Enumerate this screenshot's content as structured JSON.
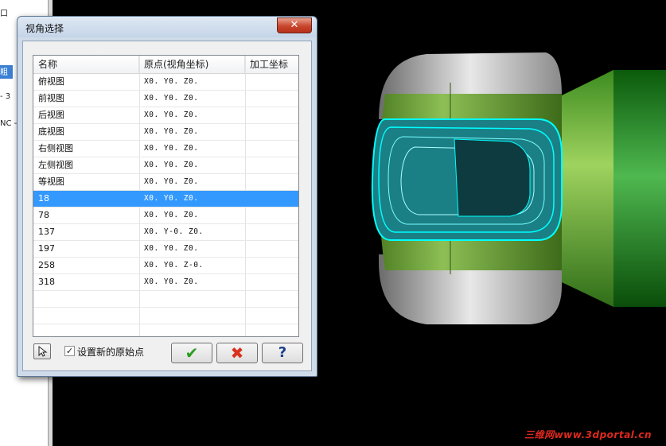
{
  "left_panel": {
    "items": [
      "口",
      "粗加",
      "- 3",
      "NC -"
    ]
  },
  "dialog": {
    "title": "视角选择",
    "close_label": "✕",
    "columns": [
      "名称",
      "原点(视角坐标)",
      "加工坐标"
    ],
    "rows": [
      {
        "name": "俯视图",
        "origin": "X0. Y0. Z0.",
        "machining": ""
      },
      {
        "name": "前视图",
        "origin": "X0. Y0. Z0.",
        "machining": ""
      },
      {
        "name": "后视图",
        "origin": "X0. Y0. Z0.",
        "machining": ""
      },
      {
        "name": "底视图",
        "origin": "X0. Y0. Z0.",
        "machining": ""
      },
      {
        "name": "右侧视图",
        "origin": "X0. Y0. Z0.",
        "machining": ""
      },
      {
        "name": "左侧视图",
        "origin": "X0. Y0. Z0.",
        "machining": ""
      },
      {
        "name": "等视图",
        "origin": "X0. Y0. Z0.",
        "machining": ""
      },
      {
        "name": "18",
        "origin": "X0. Y0. Z0.",
        "machining": "",
        "selected": true
      },
      {
        "name": "78",
        "origin": "X0. Y0. Z0.",
        "machining": ""
      },
      {
        "name": "137",
        "origin": "X0. Y-0. Z0.",
        "machining": ""
      },
      {
        "name": "197",
        "origin": "X0. Y0. Z0.",
        "machining": ""
      },
      {
        "name": "258",
        "origin": "X0. Y0. Z-0.",
        "machining": ""
      },
      {
        "name": "318",
        "origin": "X0. Y0. Z0.",
        "machining": ""
      }
    ],
    "set_origin_label": "设置新的原始点",
    "set_origin_checked": true,
    "ok_symbol": "✔",
    "cancel_symbol": "✖",
    "help_symbol": "?",
    "icons": {
      "pick": "pointer-arrow-icon",
      "ok": "checkmark-icon",
      "cancel": "red-x-icon",
      "help": "question-icon"
    },
    "colors": {
      "selection": "#3399ff",
      "ok": "#2a9d1f",
      "cancel": "#d9321f"
    }
  },
  "viewport": {
    "watermark": "三维网www.3dportal.cn",
    "colors": {
      "background": "#000000",
      "part_green": "#6da33a",
      "toolpath": "#00ffff",
      "shaft": "#1e8a1e"
    }
  }
}
